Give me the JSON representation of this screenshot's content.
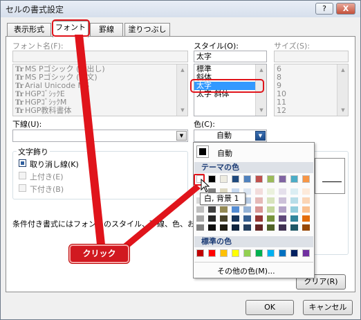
{
  "window": {
    "title": "セルの書式設定",
    "help_label": "?",
    "close_label": "X"
  },
  "tabs": [
    {
      "label": "表示形式",
      "active": false
    },
    {
      "label": "フォント",
      "active": true
    },
    {
      "label": "罫線",
      "active": false
    },
    {
      "label": "塗りつぶし",
      "active": false
    }
  ],
  "font_name": {
    "label": "フォント名(F):",
    "value": "",
    "items": [
      "MS Pゴシック (見出し)",
      "MS Pゴシック (本文)",
      "Arial Unicode MS",
      "HGPｺﾞｼｯｸE",
      "HGPｺﾞｼｯｸM",
      "HGP教科書体"
    ]
  },
  "style": {
    "label": "スタイル(O):",
    "value": "太字",
    "items": [
      "標準",
      "斜体",
      "太字",
      "太字 斜体"
    ],
    "selected_index": 2
  },
  "size": {
    "label": "サイズ(S):",
    "value": "",
    "items": [
      "6",
      "8",
      "9",
      "10",
      "11",
      "12"
    ]
  },
  "underline": {
    "label": "下線(U):",
    "value": ""
  },
  "color": {
    "label": "色(C):",
    "value": "自動"
  },
  "effects": {
    "label": "文字飾り",
    "items": [
      {
        "label": "取り消し線(K)",
        "checked": true,
        "enabled": true
      },
      {
        "label": "上付き(E)",
        "checked": false,
        "enabled": false
      },
      {
        "label": "下付き(B)",
        "checked": false,
        "enabled": false
      }
    ]
  },
  "note": "条件付き書式にはフォントのスタイル、下線、色、および取",
  "color_popup": {
    "auto_label": "自動",
    "theme_header": "テーマの色",
    "theme_colors": [
      "#ffffff",
      "#000000",
      "#eeece1",
      "#1f497d",
      "#4f81bd",
      "#c0504d",
      "#9bbb59",
      "#8064a2",
      "#4bacc6",
      "#f79646"
    ],
    "theme_shades": [
      [
        "#f2f2f2",
        "#d9d9d9",
        "#bfbfbf",
        "#a6a6a6",
        "#808080"
      ],
      [
        "#7f7f7f",
        "#595959",
        "#404040",
        "#262626",
        "#0d0d0d"
      ],
      [
        "#ddd9c3",
        "#c4bd97",
        "#948a54",
        "#4a452a",
        "#1e1c11"
      ],
      [
        "#c6d9f0",
        "#8db3e2",
        "#548dd4",
        "#17365d",
        "#0f243e"
      ],
      [
        "#dbe5f1",
        "#b8cce4",
        "#95b3d7",
        "#366092",
        "#244061"
      ],
      [
        "#f2dcdb",
        "#e5b9b7",
        "#d99694",
        "#953734",
        "#632423"
      ],
      [
        "#ebf1dd",
        "#d7e3bc",
        "#c3d69b",
        "#76923c",
        "#4f6128"
      ],
      [
        "#e5e0ec",
        "#ccc1d9",
        "#b2a2c7",
        "#5f497a",
        "#3f3151"
      ],
      [
        "#dbeef3",
        "#b7dde8",
        "#92cddc",
        "#31859b",
        "#205867"
      ],
      [
        "#fdeada",
        "#fbd5b5",
        "#fac08f",
        "#e36c09",
        "#974806"
      ]
    ],
    "standard_header": "標準の色",
    "standard_colors": [
      "#c00000",
      "#ff0000",
      "#ffc000",
      "#ffff00",
      "#92d050",
      "#00b050",
      "#00b0f0",
      "#0070c0",
      "#002060",
      "#7030a0"
    ],
    "more_colors_label": "その他の色(M)..."
  },
  "tooltip": "白, 背景 1",
  "callout": "クリック",
  "buttons": {
    "clear": "クリア(R)",
    "ok": "OK",
    "cancel": "キャンセル"
  },
  "icons": {
    "font_type": "Tr",
    "dropdown": "▼",
    "scroll_up": "▲",
    "scroll_down": "▼"
  }
}
